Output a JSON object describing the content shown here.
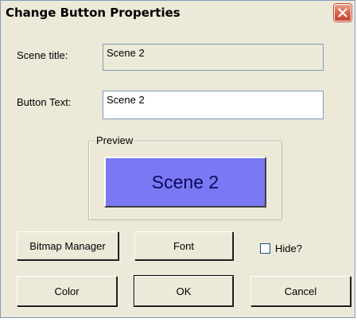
{
  "window": {
    "title": "Change Button Properties"
  },
  "fields": {
    "scene_title_label": "Scene title:",
    "scene_title_value": "Scene 2",
    "button_text_label": "Button Text:",
    "button_text_value": "Scene 2"
  },
  "preview": {
    "group_label": "Preview",
    "button_label": "Scene 2",
    "button_color": "#7b78f4"
  },
  "buttons": {
    "bitmap_manager": "Bitmap Manager",
    "font": "Font",
    "hide_label": "Hide?",
    "hide_checked": false,
    "color": "Color",
    "ok": "OK",
    "cancel": "Cancel"
  },
  "icons": {
    "close": "close-icon"
  }
}
